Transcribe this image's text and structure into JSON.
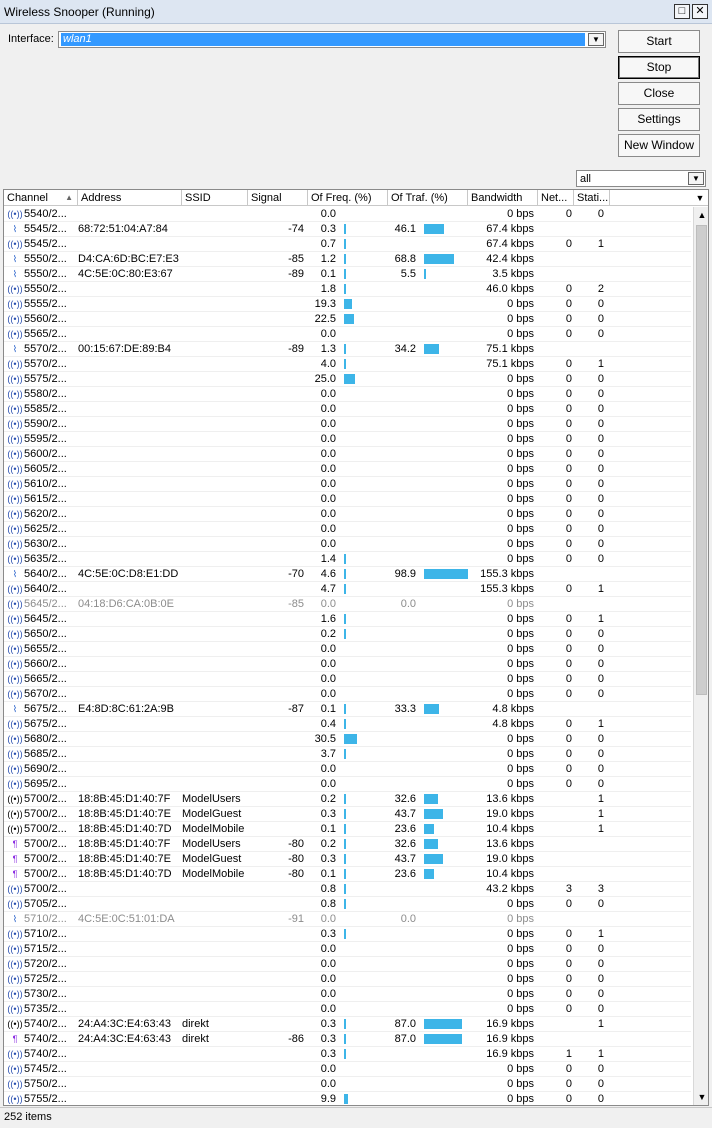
{
  "window": {
    "title": "Wireless Snooper (Running)",
    "restore_glyph": "□",
    "close_glyph": "✕"
  },
  "interface": {
    "label": "Interface:",
    "value": "wlan1"
  },
  "buttons": {
    "start": "Start",
    "stop": "Stop",
    "close": "Close",
    "settings": "Settings",
    "new_window": "New Window"
  },
  "filter": {
    "value": "all"
  },
  "icons": {
    "combo_arrow": "▼",
    "sort_arrow": "▲",
    "scroll_up": "▲",
    "scroll_down": "▼"
  },
  "columns": [
    "Channel",
    "Address",
    "SSID",
    "Signal",
    "Of Freq. (%)",
    "Of Traf. (%)",
    "Bandwidth",
    "Net...",
    "Stati..."
  ],
  "bar_color": "#3db5e8",
  "rows": [
    {
      "icon": "ap",
      "channel": "5540/2...",
      "address": "",
      "ssid": "",
      "signal": "",
      "freq": "0.0",
      "traf": "",
      "bandwidth": "0 bps",
      "net": "0",
      "sta": "0"
    },
    {
      "icon": "sta",
      "channel": "5545/2...",
      "address": "68:72:51:04:A7:84",
      "ssid": "",
      "signal": "-74",
      "freq": "0.3",
      "traf": "46.1",
      "bandwidth": "67.4 kbps",
      "net": "",
      "sta": ""
    },
    {
      "icon": "ap",
      "channel": "5545/2...",
      "address": "",
      "ssid": "",
      "signal": "",
      "freq": "0.7",
      "traf": "",
      "bandwidth": "67.4 kbps",
      "net": "0",
      "sta": "1"
    },
    {
      "icon": "sta",
      "channel": "5550/2...",
      "address": "D4:CA:6D:BC:E7:E3",
      "ssid": "",
      "signal": "-85",
      "freq": "1.2",
      "traf": "68.8",
      "bandwidth": "42.4 kbps",
      "net": "",
      "sta": ""
    },
    {
      "icon": "sta",
      "channel": "5550/2...",
      "address": "4C:5E:0C:80:E3:67",
      "ssid": "",
      "signal": "-89",
      "freq": "0.1",
      "traf": "5.5",
      "bandwidth": "3.5 kbps",
      "net": "",
      "sta": ""
    },
    {
      "icon": "ap",
      "channel": "5550/2...",
      "address": "",
      "ssid": "",
      "signal": "",
      "freq": "1.8",
      "traf": "",
      "bandwidth": "46.0 kbps",
      "net": "0",
      "sta": "2"
    },
    {
      "icon": "ap",
      "channel": "5555/2...",
      "address": "",
      "ssid": "",
      "signal": "",
      "freq": "19.3",
      "traf": "",
      "bandwidth": "0 bps",
      "net": "0",
      "sta": "0"
    },
    {
      "icon": "ap",
      "channel": "5560/2...",
      "address": "",
      "ssid": "",
      "signal": "",
      "freq": "22.5",
      "traf": "",
      "bandwidth": "0 bps",
      "net": "0",
      "sta": "0"
    },
    {
      "icon": "ap",
      "channel": "5565/2...",
      "address": "",
      "ssid": "",
      "signal": "",
      "freq": "0.0",
      "traf": "",
      "bandwidth": "0 bps",
      "net": "0",
      "sta": "0"
    },
    {
      "icon": "sta",
      "channel": "5570/2...",
      "address": "00:15:67:DE:89:B4",
      "ssid": "",
      "signal": "-89",
      "freq": "1.3",
      "traf": "34.2",
      "bandwidth": "75.1 kbps",
      "net": "",
      "sta": ""
    },
    {
      "icon": "ap",
      "channel": "5570/2...",
      "address": "",
      "ssid": "",
      "signal": "",
      "freq": "4.0",
      "traf": "",
      "bandwidth": "75.1 kbps",
      "net": "0",
      "sta": "1"
    },
    {
      "icon": "ap",
      "channel": "5575/2...",
      "address": "",
      "ssid": "",
      "signal": "",
      "freq": "25.0",
      "traf": "",
      "bandwidth": "0 bps",
      "net": "0",
      "sta": "0"
    },
    {
      "icon": "ap",
      "channel": "5580/2...",
      "address": "",
      "ssid": "",
      "signal": "",
      "freq": "0.0",
      "traf": "",
      "bandwidth": "0 bps",
      "net": "0",
      "sta": "0"
    },
    {
      "icon": "ap",
      "channel": "5585/2...",
      "address": "",
      "ssid": "",
      "signal": "",
      "freq": "0.0",
      "traf": "",
      "bandwidth": "0 bps",
      "net": "0",
      "sta": "0"
    },
    {
      "icon": "ap",
      "channel": "5590/2...",
      "address": "",
      "ssid": "",
      "signal": "",
      "freq": "0.0",
      "traf": "",
      "bandwidth": "0 bps",
      "net": "0",
      "sta": "0"
    },
    {
      "icon": "ap",
      "channel": "5595/2...",
      "address": "",
      "ssid": "",
      "signal": "",
      "freq": "0.0",
      "traf": "",
      "bandwidth": "0 bps",
      "net": "0",
      "sta": "0"
    },
    {
      "icon": "ap",
      "channel": "5600/2...",
      "address": "",
      "ssid": "",
      "signal": "",
      "freq": "0.0",
      "traf": "",
      "bandwidth": "0 bps",
      "net": "0",
      "sta": "0"
    },
    {
      "icon": "ap",
      "channel": "5605/2...",
      "address": "",
      "ssid": "",
      "signal": "",
      "freq": "0.0",
      "traf": "",
      "bandwidth": "0 bps",
      "net": "0",
      "sta": "0"
    },
    {
      "icon": "ap",
      "channel": "5610/2...",
      "address": "",
      "ssid": "",
      "signal": "",
      "freq": "0.0",
      "traf": "",
      "bandwidth": "0 bps",
      "net": "0",
      "sta": "0"
    },
    {
      "icon": "ap",
      "channel": "5615/2...",
      "address": "",
      "ssid": "",
      "signal": "",
      "freq": "0.0",
      "traf": "",
      "bandwidth": "0 bps",
      "net": "0",
      "sta": "0"
    },
    {
      "icon": "ap",
      "channel": "5620/2...",
      "address": "",
      "ssid": "",
      "signal": "",
      "freq": "0.0",
      "traf": "",
      "bandwidth": "0 bps",
      "net": "0",
      "sta": "0"
    },
    {
      "icon": "ap",
      "channel": "5625/2...",
      "address": "",
      "ssid": "",
      "signal": "",
      "freq": "0.0",
      "traf": "",
      "bandwidth": "0 bps",
      "net": "0",
      "sta": "0"
    },
    {
      "icon": "ap",
      "channel": "5630/2...",
      "address": "",
      "ssid": "",
      "signal": "",
      "freq": "0.0",
      "traf": "",
      "bandwidth": "0 bps",
      "net": "0",
      "sta": "0"
    },
    {
      "icon": "ap",
      "channel": "5635/2...",
      "address": "",
      "ssid": "",
      "signal": "",
      "freq": "1.4",
      "traf": "",
      "bandwidth": "0 bps",
      "net": "0",
      "sta": "0"
    },
    {
      "icon": "sta",
      "channel": "5640/2...",
      "address": "4C:5E:0C:D8:E1:DD",
      "ssid": "",
      "signal": "-70",
      "freq": "4.6",
      "traf": "98.9",
      "bandwidth": "155.3 kbps",
      "net": "",
      "sta": ""
    },
    {
      "icon": "ap",
      "channel": "5640/2...",
      "address": "",
      "ssid": "",
      "signal": "",
      "freq": "4.7",
      "traf": "",
      "bandwidth": "155.3 kbps",
      "net": "0",
      "sta": "1"
    },
    {
      "icon": "ap",
      "channel": "5645/2...",
      "address": "04:18:D6:CA:0B:0E",
      "ssid": "",
      "signal": "-85",
      "freq": "0.0",
      "traf": "0.0",
      "bandwidth": "0 bps",
      "net": "",
      "sta": "",
      "inactive": true
    },
    {
      "icon": "ap",
      "channel": "5645/2...",
      "address": "",
      "ssid": "",
      "signal": "",
      "freq": "1.6",
      "traf": "",
      "bandwidth": "0 bps",
      "net": "0",
      "sta": "1"
    },
    {
      "icon": "ap",
      "channel": "5650/2...",
      "address": "",
      "ssid": "",
      "signal": "",
      "freq": "0.2",
      "traf": "",
      "bandwidth": "0 bps",
      "net": "0",
      "sta": "0"
    },
    {
      "icon": "ap",
      "channel": "5655/2...",
      "address": "",
      "ssid": "",
      "signal": "",
      "freq": "0.0",
      "traf": "",
      "bandwidth": "0 bps",
      "net": "0",
      "sta": "0"
    },
    {
      "icon": "ap",
      "channel": "5660/2...",
      "address": "",
      "ssid": "",
      "signal": "",
      "freq": "0.0",
      "traf": "",
      "bandwidth": "0 bps",
      "net": "0",
      "sta": "0"
    },
    {
      "icon": "ap",
      "channel": "5665/2...",
      "address": "",
      "ssid": "",
      "signal": "",
      "freq": "0.0",
      "traf": "",
      "bandwidth": "0 bps",
      "net": "0",
      "sta": "0"
    },
    {
      "icon": "ap",
      "channel": "5670/2...",
      "address": "",
      "ssid": "",
      "signal": "",
      "freq": "0.0",
      "traf": "",
      "bandwidth": "0 bps",
      "net": "0",
      "sta": "0"
    },
    {
      "icon": "sta",
      "channel": "5675/2...",
      "address": "E4:8D:8C:61:2A:9B",
      "ssid": "",
      "signal": "-87",
      "freq": "0.1",
      "traf": "33.3",
      "bandwidth": "4.8 kbps",
      "net": "",
      "sta": ""
    },
    {
      "icon": "ap",
      "channel": "5675/2...",
      "address": "",
      "ssid": "",
      "signal": "",
      "freq": "0.4",
      "traf": "",
      "bandwidth": "4.8 kbps",
      "net": "0",
      "sta": "1"
    },
    {
      "icon": "ap",
      "channel": "5680/2...",
      "address": "",
      "ssid": "",
      "signal": "",
      "freq": "30.5",
      "traf": "",
      "bandwidth": "0 bps",
      "net": "0",
      "sta": "0"
    },
    {
      "icon": "ap",
      "channel": "5685/2...",
      "address": "",
      "ssid": "",
      "signal": "",
      "freq": "3.7",
      "traf": "",
      "bandwidth": "0 bps",
      "net": "0",
      "sta": "0"
    },
    {
      "icon": "ap",
      "channel": "5690/2...",
      "address": "",
      "ssid": "",
      "signal": "",
      "freq": "0.0",
      "traf": "",
      "bandwidth": "0 bps",
      "net": "0",
      "sta": "0"
    },
    {
      "icon": "ap",
      "channel": "5695/2...",
      "address": "",
      "ssid": "",
      "signal": "",
      "freq": "0.0",
      "traf": "",
      "bandwidth": "0 bps",
      "net": "0",
      "sta": "0"
    },
    {
      "icon": "net",
      "channel": "5700/2...",
      "address": "18:8B:45:D1:40:7F",
      "ssid": "ModelUsers",
      "signal": "",
      "freq": "0.2",
      "traf": "32.6",
      "bandwidth": "13.6 kbps",
      "net": "",
      "sta": "1"
    },
    {
      "icon": "net",
      "channel": "5700/2...",
      "address": "18:8B:45:D1:40:7E",
      "ssid": "ModelGuest",
      "signal": "",
      "freq": "0.3",
      "traf": "43.7",
      "bandwidth": "19.0 kbps",
      "net": "",
      "sta": "1"
    },
    {
      "icon": "net",
      "channel": "5700/2...",
      "address": "18:8B:45:D1:40:7D",
      "ssid": "ModelMobile",
      "signal": "",
      "freq": "0.1",
      "traf": "23.6",
      "bandwidth": "10.4 kbps",
      "net": "",
      "sta": "1"
    },
    {
      "icon": "st2",
      "channel": "5700/2...",
      "address": "18:8B:45:D1:40:7F",
      "ssid": "ModelUsers",
      "signal": "-80",
      "freq": "0.2",
      "traf": "32.6",
      "bandwidth": "13.6 kbps",
      "net": "",
      "sta": ""
    },
    {
      "icon": "st2",
      "channel": "5700/2...",
      "address": "18:8B:45:D1:40:7E",
      "ssid": "ModelGuest",
      "signal": "-80",
      "freq": "0.3",
      "traf": "43.7",
      "bandwidth": "19.0 kbps",
      "net": "",
      "sta": ""
    },
    {
      "icon": "st2",
      "channel": "5700/2...",
      "address": "18:8B:45:D1:40:7D",
      "ssid": "ModelMobile",
      "signal": "-80",
      "freq": "0.1",
      "traf": "23.6",
      "bandwidth": "10.4 kbps",
      "net": "",
      "sta": ""
    },
    {
      "icon": "ap",
      "channel": "5700/2...",
      "address": "",
      "ssid": "",
      "signal": "",
      "freq": "0.8",
      "traf": "",
      "bandwidth": "43.2 kbps",
      "net": "3",
      "sta": "3"
    },
    {
      "icon": "ap",
      "channel": "5705/2...",
      "address": "",
      "ssid": "",
      "signal": "",
      "freq": "0.8",
      "traf": "",
      "bandwidth": "0 bps",
      "net": "0",
      "sta": "0"
    },
    {
      "icon": "sta",
      "channel": "5710/2...",
      "address": "4C:5E:0C:51:01:DA",
      "ssid": "",
      "signal": "-91",
      "freq": "0.0",
      "traf": "0.0",
      "bandwidth": "0 bps",
      "net": "",
      "sta": "",
      "inactive": true
    },
    {
      "icon": "ap",
      "channel": "5710/2...",
      "address": "",
      "ssid": "",
      "signal": "",
      "freq": "0.3",
      "traf": "",
      "bandwidth": "0 bps",
      "net": "0",
      "sta": "1"
    },
    {
      "icon": "ap",
      "channel": "5715/2...",
      "address": "",
      "ssid": "",
      "signal": "",
      "freq": "0.0",
      "traf": "",
      "bandwidth": "0 bps",
      "net": "0",
      "sta": "0"
    },
    {
      "icon": "ap",
      "channel": "5720/2...",
      "address": "",
      "ssid": "",
      "signal": "",
      "freq": "0.0",
      "traf": "",
      "bandwidth": "0 bps",
      "net": "0",
      "sta": "0"
    },
    {
      "icon": "ap",
      "channel": "5725/2...",
      "address": "",
      "ssid": "",
      "signal": "",
      "freq": "0.0",
      "traf": "",
      "bandwidth": "0 bps",
      "net": "0",
      "sta": "0"
    },
    {
      "icon": "ap",
      "channel": "5730/2...",
      "address": "",
      "ssid": "",
      "signal": "",
      "freq": "0.0",
      "traf": "",
      "bandwidth": "0 bps",
      "net": "0",
      "sta": "0"
    },
    {
      "icon": "ap",
      "channel": "5735/2...",
      "address": "",
      "ssid": "",
      "signal": "",
      "freq": "0.0",
      "traf": "",
      "bandwidth": "0 bps",
      "net": "0",
      "sta": "0"
    },
    {
      "icon": "net",
      "channel": "5740/2...",
      "address": "24:A4:3C:E4:63:43",
      "ssid": "direkt",
      "signal": "",
      "freq": "0.3",
      "traf": "87.0",
      "bandwidth": "16.9 kbps",
      "net": "",
      "sta": "1"
    },
    {
      "icon": "st2",
      "channel": "5740/2...",
      "address": "24:A4:3C:E4:63:43",
      "ssid": "direkt",
      "signal": "-86",
      "freq": "0.3",
      "traf": "87.0",
      "bandwidth": "16.9 kbps",
      "net": "",
      "sta": ""
    },
    {
      "icon": "ap",
      "channel": "5740/2...",
      "address": "",
      "ssid": "",
      "signal": "",
      "freq": "0.3",
      "traf": "",
      "bandwidth": "16.9 kbps",
      "net": "1",
      "sta": "1"
    },
    {
      "icon": "ap",
      "channel": "5745/2...",
      "address": "",
      "ssid": "",
      "signal": "",
      "freq": "0.0",
      "traf": "",
      "bandwidth": "0 bps",
      "net": "0",
      "sta": "0"
    },
    {
      "icon": "ap",
      "channel": "5750/2...",
      "address": "",
      "ssid": "",
      "signal": "",
      "freq": "0.0",
      "traf": "",
      "bandwidth": "0 bps",
      "net": "0",
      "sta": "0"
    },
    {
      "icon": "ap",
      "channel": "5755/2...",
      "address": "",
      "ssid": "",
      "signal": "",
      "freq": "9.9",
      "traf": "",
      "bandwidth": "0 bps",
      "net": "0",
      "sta": "0"
    }
  ],
  "status": {
    "items": "252 items"
  }
}
